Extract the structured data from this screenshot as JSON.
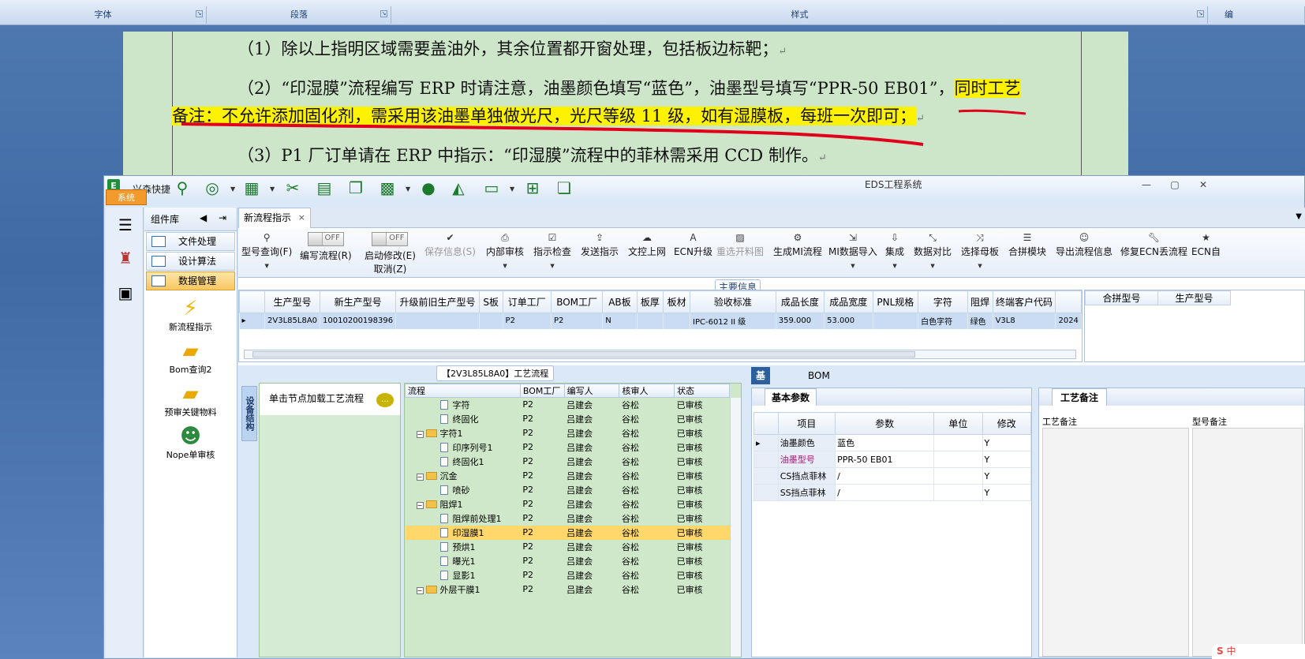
{
  "ribbon": {
    "groups": [
      "字体",
      "段落",
      "样式",
      "编"
    ]
  },
  "document": {
    "line1": "（1）除以上指明区域需要盖油外，其余位置都开窗处理，包括板边标靶；",
    "line2_normal": "（2）“印湿膜”流程编写 ERP 时请注意，油墨颜色填写“蓝色”，油墨型号填写“PPR-50 EB01”，",
    "line2_highlight": "同时工艺",
    "line3_highlight": "备注：不允许添加固化剂，需采用该油墨单独做光尺，光尺等级 11 级，如有湿膜板，每班一次即可；",
    "line4": "（3）P1 厂订单请在 ERP 中指示：“印湿膜”流程中的菲林需采用 CCD 制作。",
    "para_mark": "↵"
  },
  "titlebar": {
    "app_icon": "EDS-logo-icon",
    "quick_label": "兴森快捷",
    "title": "EDS工程系统",
    "min": "—",
    "max": "▢",
    "close": "✕"
  },
  "system_tab": "系统",
  "component_panel": {
    "title": "组件库",
    "menu": [
      "文件处理",
      "设计算法",
      "数据管理"
    ],
    "tools": [
      "新流程指示",
      "Bom查询2",
      "预审关键物料",
      "Nope单审核"
    ]
  },
  "doc_tab": {
    "label": "新流程指示",
    "close": "×"
  },
  "toolbar": {
    "btn_query": "型号查询(F)",
    "btn_write": "编写流程(R)",
    "toggle_off": "OFF",
    "btn_auto1": "启动修改(E)",
    "btn_auto2": "取消(Z)",
    "btn_save": "保存信息(S)",
    "btn_inner": "内部审核",
    "btn_check": "指示检查",
    "btn_send": "发送指示",
    "btn_upload": "文控上网",
    "btn_ecn": "ECN升级",
    "btn_reselect": "重选开料图",
    "btn_gen": "生成MI流程",
    "btn_mi_import": "MI数据导入",
    "btn_integrate": "集成",
    "btn_compare": "数据对比",
    "btn_mother": "选择母板",
    "btn_module": "合拼模块",
    "btn_export": "导出流程信息",
    "btn_fix_ecn": "修复ECN丢流程",
    "btn_ecn_self": "ECN自"
  },
  "main_info": {
    "header": "主要信息",
    "columns": [
      "生产型号",
      "新生产型号",
      "升级前旧生产型号",
      "S板",
      "订单工厂",
      "BOM工厂",
      "AB板",
      "板厚",
      "板材",
      "验收标准",
      "成品长度",
      "成品宽度",
      "PNL规格",
      "字符",
      "阻焊",
      "终端客户代码",
      ""
    ],
    "row": [
      "2V3L85L8A0",
      "10010200198396",
      "",
      "",
      "P2",
      "P2",
      "N",
      "",
      "",
      "IPC-6012 II 级",
      "359.000",
      "53.000",
      "",
      "白色字符",
      "绿色",
      "V3L8",
      "2024"
    ],
    "side_columns": [
      "合拼型号",
      "生产型号"
    ]
  },
  "process": {
    "header": "【2V3L85L8A0】工艺流程",
    "vertical_tab": "设备结构",
    "node_hint": "单击节点加载工艺流程",
    "columns": [
      "流程",
      "BOM工厂",
      "编写人",
      "核审人",
      "状态"
    ],
    "rows": [
      {
        "name": "字符",
        "kind": "file",
        "indent": 2,
        "factory": "P2",
        "writer": "吕建会",
        "reviewer": "谷松",
        "status": "已审核"
      },
      {
        "name": "终固化",
        "kind": "file",
        "indent": 2,
        "factory": "P2",
        "writer": "吕建会",
        "reviewer": "谷松",
        "status": "已审核"
      },
      {
        "name": "字符1",
        "kind": "folder",
        "indent": 1,
        "factory": "P2",
        "writer": "吕建会",
        "reviewer": "谷松",
        "status": "已审核"
      },
      {
        "name": "印序列号1",
        "kind": "file",
        "indent": 2,
        "factory": "P2",
        "writer": "吕建会",
        "reviewer": "谷松",
        "status": "已审核"
      },
      {
        "name": "终固化1",
        "kind": "file",
        "indent": 2,
        "factory": "P2",
        "writer": "吕建会",
        "reviewer": "谷松",
        "status": "已审核"
      },
      {
        "name": "沉金",
        "kind": "folder",
        "indent": 1,
        "factory": "P2",
        "writer": "吕建会",
        "reviewer": "谷松",
        "status": "已审核"
      },
      {
        "name": "喷砂",
        "kind": "file",
        "indent": 2,
        "factory": "P2",
        "writer": "吕建会",
        "reviewer": "谷松",
        "status": "已审核"
      },
      {
        "name": "阻焊1",
        "kind": "folder",
        "indent": 1,
        "factory": "P2",
        "writer": "吕建会",
        "reviewer": "谷松",
        "status": "已审核"
      },
      {
        "name": "阻焊前处理1",
        "kind": "file",
        "indent": 2,
        "factory": "P2",
        "writer": "吕建会",
        "reviewer": "谷松",
        "status": "已审核"
      },
      {
        "name": "印湿膜1",
        "kind": "file",
        "indent": 2,
        "factory": "P2",
        "writer": "吕建会",
        "reviewer": "谷松",
        "status": "已审核",
        "selected": true
      },
      {
        "name": "预烘1",
        "kind": "file",
        "indent": 2,
        "factory": "P2",
        "writer": "吕建会",
        "reviewer": "谷松",
        "status": "已审核"
      },
      {
        "name": "曝光1",
        "kind": "file",
        "indent": 2,
        "factory": "P2",
        "writer": "吕建会",
        "reviewer": "谷松",
        "status": "已审核"
      },
      {
        "name": "显影1",
        "kind": "file",
        "indent": 2,
        "factory": "P2",
        "writer": "吕建会",
        "reviewer": "谷松",
        "status": "已审核"
      },
      {
        "name": "外层干膜1",
        "kind": "folder",
        "indent": 1,
        "factory": "P2",
        "writer": "吕建会",
        "reviewer": "谷松",
        "status": "已审核"
      }
    ]
  },
  "detail": {
    "tab_basic": "基本信息",
    "tab_bom": "BOM",
    "params_title": "基本参数",
    "param_columns": [
      "项目",
      "参数",
      "单位",
      "修改"
    ],
    "params": [
      {
        "item": "油墨颜色",
        "value": "蓝色",
        "unit": "",
        "edit": "Y"
      },
      {
        "item": "油墨型号",
        "value": "PPR-50 EB01",
        "unit": "",
        "edit": "Y",
        "accent": "#b0127a"
      },
      {
        "item": "CS挡点菲林",
        "value": "/",
        "unit": "",
        "edit": "Y"
      },
      {
        "item": "SS挡点菲林",
        "value": "/",
        "unit": "",
        "edit": "Y"
      }
    ],
    "notes_title": "工艺备注",
    "notes_label": "工艺备注",
    "notes_label2": "型号备注"
  },
  "ime": {
    "label": "中"
  },
  "colors": {
    "highlight": "#fff200",
    "doc_bg": "#cde6c9",
    "accent_red": "#e0001b",
    "selected_row": "#ffd76a",
    "tab_active": "#2c5f9e"
  }
}
